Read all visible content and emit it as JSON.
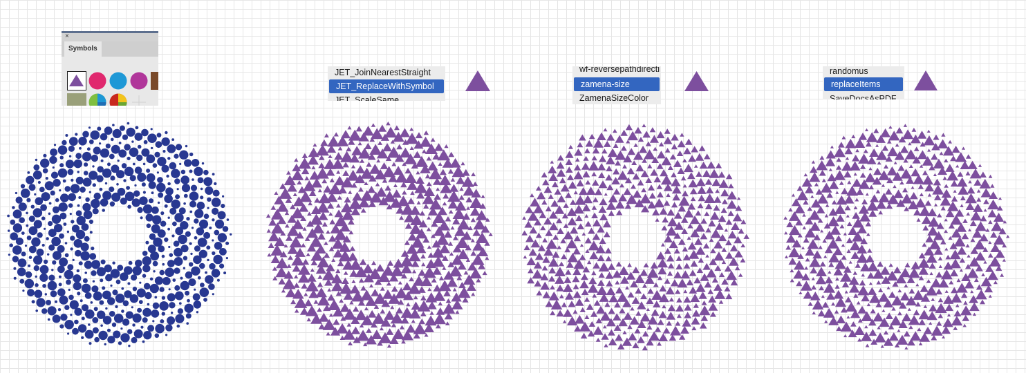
{
  "symbols_panel": {
    "tab_label": "Symbols",
    "close_glyph": "×",
    "swatches": [
      {
        "icon": "purple-triangle-symbol",
        "color": "#7d4f9e"
      },
      {
        "icon": "pink-circle-symbol",
        "color": "#e0286e"
      },
      {
        "icon": "blue-circle-symbol",
        "color": "#1e98d6"
      },
      {
        "icon": "magenta-circle-symbol",
        "color": "#b0369a"
      },
      {
        "icon": "brown-square-symbol",
        "color": "#7a4a2a"
      },
      {
        "icon": "olive-square-symbol",
        "color": "#9aa07a"
      },
      {
        "icon": "green-blue-pie-symbol",
        "color": "#7fbf3f"
      },
      {
        "icon": "red-yellow-pie-symbol",
        "color": "#c8281e"
      },
      {
        "icon": "crosshair-symbol",
        "color": "#cccccc"
      }
    ]
  },
  "scripts": {
    "list1": [
      "JET_JoinNearestStraight",
      "JET_ReplaceWithSymbol",
      "JET_ScaleSame"
    ],
    "list2": [
      "wf-reversepathdirecti",
      "zamena-size",
      "ZamenaSizeColor"
    ],
    "list3": [
      "randomus",
      "replaceItems",
      "SaveDocsAsPDF"
    ]
  },
  "colors": {
    "dot_blue": "#283891",
    "triangle_purple": "#7d4f9e",
    "selection_blue": "#3366c0"
  },
  "canvas": {
    "spiral_count": 4
  }
}
